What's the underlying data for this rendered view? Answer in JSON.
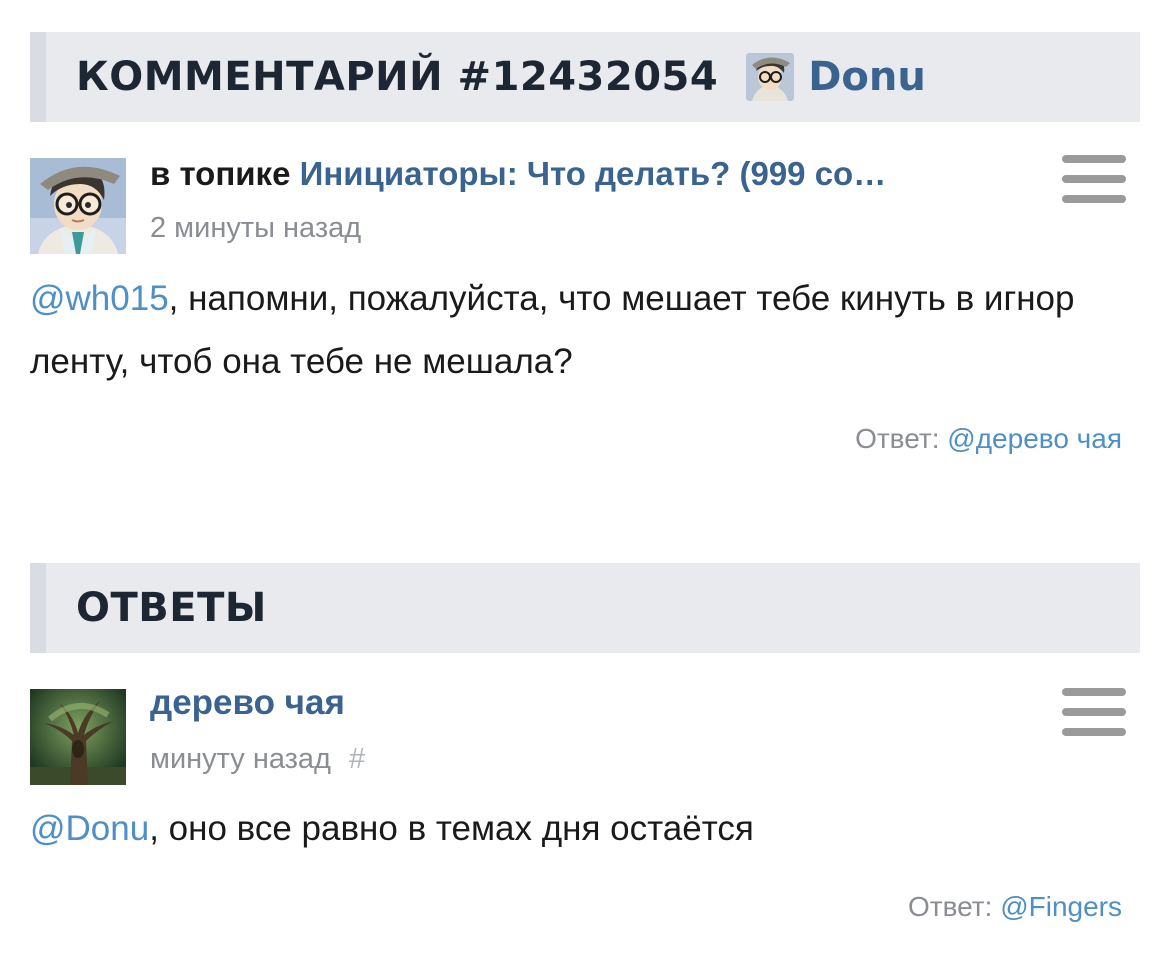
{
  "comment": {
    "header_title": "КОММЕНТАРИЙ #12432054",
    "header_user": "Donu",
    "topic_prefix": "в топике",
    "topic_title": "Инициаторы: Что делать? (999 со…",
    "time": "2 минуты назад",
    "mention": "@wh015",
    "text": ", напомни, пожалуйста, что мешает тебе кинуть в игнор ленту, чтоб она тебе не мешала?",
    "reply_label": "Ответ:",
    "reply_mention": "@дерево чая"
  },
  "replies_section": {
    "title": "ОТВЕТЫ",
    "items": [
      {
        "author": "дерево чая",
        "time": "минуту назад",
        "hash": "#",
        "mention": "@Donu",
        "text": ", оно все равно в темах дня остаётся",
        "reply_label": "Ответ:",
        "reply_mention": "@Fingers"
      }
    ]
  },
  "icons": {
    "menu": "hamburger-menu-icon",
    "avatar_donu": "anime-boy-glasses-avatar",
    "avatar_tree": "tree-avatar"
  },
  "colors": {
    "link": "#3a6390",
    "mention": "#4f8fc7",
    "header_bg": "#e8eaee",
    "muted": "#8a8d93"
  }
}
